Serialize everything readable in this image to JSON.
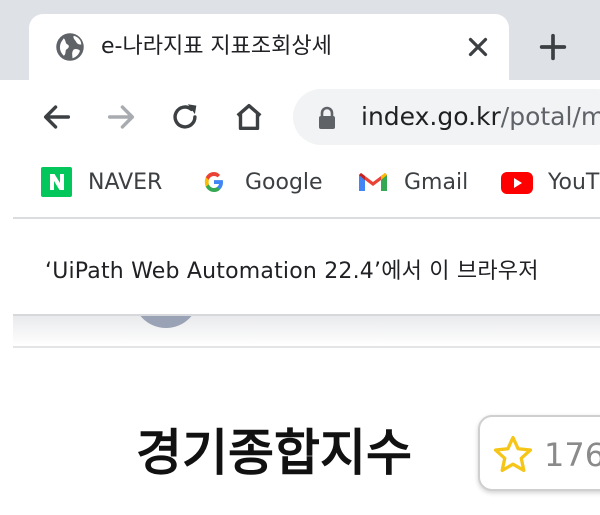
{
  "tab": {
    "title": "e-나라지표 지표조회상세",
    "favicon": "globe-icon",
    "close_icon": "close-icon"
  },
  "new_tab_icon": "plus-icon",
  "toolbar": {
    "back_icon": "arrow-left-icon",
    "forward_icon": "arrow-right-icon",
    "reload_icon": "reload-icon",
    "home_icon": "home-icon",
    "url_host": "index.go.kr",
    "url_path": "/potal/m"
  },
  "bookmarks": [
    {
      "label": "NAVER",
      "icon": "naver-icon"
    },
    {
      "label": "Google",
      "icon": "google-icon"
    },
    {
      "label": "Gmail",
      "icon": "gmail-icon"
    },
    {
      "label": "YouT",
      "icon": "youtube-icon"
    }
  ],
  "infobar": {
    "text": "‘UiPath Web Automation 22.4’에서 이 브라우저"
  },
  "page": {
    "title": "경기종합지수",
    "favorite_icon": "star-icon",
    "favorite_count": "176"
  },
  "colors": {
    "tab_strip": "#dee1e6",
    "omnibox": "#f1f3f4",
    "naver_green": "#03c75a",
    "youtube_red": "#ff0000",
    "star_yellow": "#f5c518"
  }
}
